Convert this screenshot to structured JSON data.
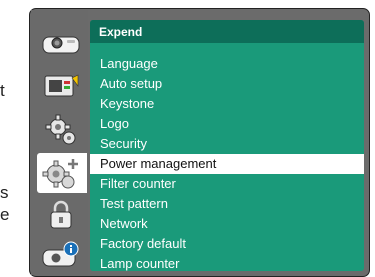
{
  "left_edge_text": [
    "t",
    "s",
    "e"
  ],
  "sidebar": {
    "items": [
      {
        "icon": "projector-icon",
        "active": false
      },
      {
        "icon": "input-source-icon",
        "active": false
      },
      {
        "icon": "gear-icon",
        "active": false
      },
      {
        "icon": "expand-settings-icon",
        "active": true
      },
      {
        "icon": "lock-icon",
        "active": false
      },
      {
        "icon": "info-icon",
        "active": false
      }
    ]
  },
  "menu": {
    "title": "Expend",
    "items": [
      "Language",
      "Auto setup",
      "Keystone",
      "Logo",
      "Security",
      "Power management",
      "Filter counter",
      "Test pattern",
      "Network",
      "Factory default",
      "Lamp counter"
    ],
    "selected_index": 5
  },
  "colors": {
    "menu_background": "#1a9a7a",
    "menu_header": "#0d6e59",
    "frame": "#6b6b6b",
    "selected_row": "#ffffff"
  }
}
